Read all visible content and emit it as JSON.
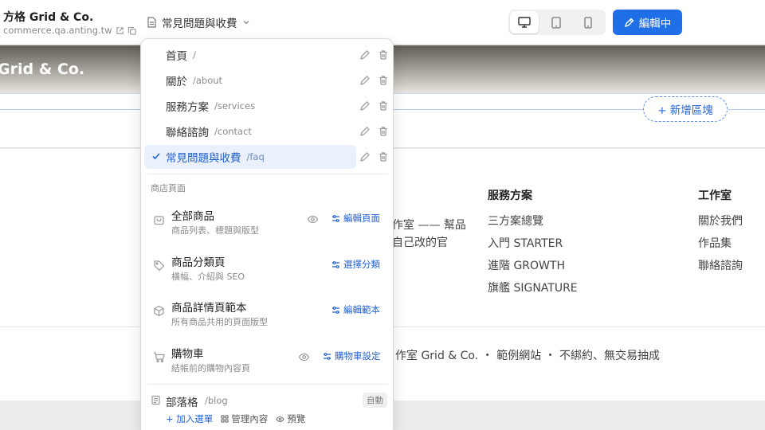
{
  "topbar": {
    "site_title": "方格 Grid & Co.",
    "site_url": "commerce.qa.anting.tw",
    "current_page": "常見問題與收費",
    "edit_label": "編輯中"
  },
  "hero": {
    "brand": "Grid & Co."
  },
  "add_block_label": "+ 新增區塊",
  "footer": {
    "desc_line1": "作室 —— 幫品",
    "desc_line2": "自己改的官",
    "services_title": "服務方案",
    "services_links": [
      "三方案總覽",
      "入門 STARTER",
      "進階 GROWTH",
      "旗艦 SIGNATURE"
    ],
    "studio_title": "工作室",
    "studio_links": [
      "關於我們",
      "作品集",
      "聯絡諮詢"
    ],
    "copyright": "作室 Grid & Co. ・ 範例網站 ・ 不綁約、無交易抽成"
  },
  "menu": {
    "pages": [
      {
        "label": "首頁",
        "slug": "/"
      },
      {
        "label": "關於",
        "slug": "/about"
      },
      {
        "label": "服務方案",
        "slug": "/services"
      },
      {
        "label": "聯絡諮詢",
        "slug": "/contact"
      },
      {
        "label": "常見問題與收費",
        "slug": "/faq"
      }
    ],
    "section_label": "商店頁面",
    "shop": [
      {
        "title": "全部商品",
        "sub": "商品列表、標題與版型",
        "link": "編輯頁面"
      },
      {
        "title": "商品分類頁",
        "sub": "橫幅、介紹與 SEO",
        "link": "選擇分類"
      },
      {
        "title": "商品詳情頁範本",
        "sub": "所有商品共用的頁面版型",
        "link": "編輯範本"
      },
      {
        "title": "購物車",
        "sub": "結帳前的購物內容頁",
        "link": "購物車設定"
      }
    ],
    "blog": {
      "title": "部落格",
      "slug": "/blog",
      "badge": "自動",
      "add_menu": "+ 加入選單",
      "manage": "管理內容",
      "preview": "預覽"
    }
  },
  "colors": {
    "accent": "#1f6fe8",
    "selected_bg": "#eaf1fd"
  }
}
